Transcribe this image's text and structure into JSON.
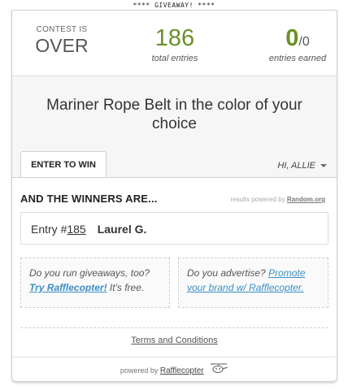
{
  "banner": "**** GIVEAWAY! ****",
  "stats": {
    "status_small": "CONTEST IS",
    "status_big": "OVER",
    "total_entries": "186",
    "total_entries_label": "total entries",
    "entries_earned": "0",
    "entries_earned_total": "/0",
    "entries_earned_label": "entries earned"
  },
  "prize": {
    "title": "Mariner Rope Belt in the color of your choice"
  },
  "tabs": {
    "enter": "ENTER TO WIN",
    "user": "HI, ALLIE"
  },
  "winners": {
    "title": "AND THE WINNERS ARE...",
    "powered_prefix": "results powered by ",
    "powered_link": "Random.org",
    "entry_prefix": "Entry #",
    "entry_number": "185",
    "winner_name": "Laurel G."
  },
  "promo_left": {
    "question": "Do you run giveaways, too?",
    "link": "Try Rafflecopter!",
    "suffix": " It's free."
  },
  "promo_right": {
    "question": "Do you advertise? ",
    "link": "Promote your brand w/ Rafflecopter."
  },
  "terms": "Terms and Conditions",
  "footer": {
    "prefix": "powered by ",
    "brand": "Rafflecopter"
  }
}
